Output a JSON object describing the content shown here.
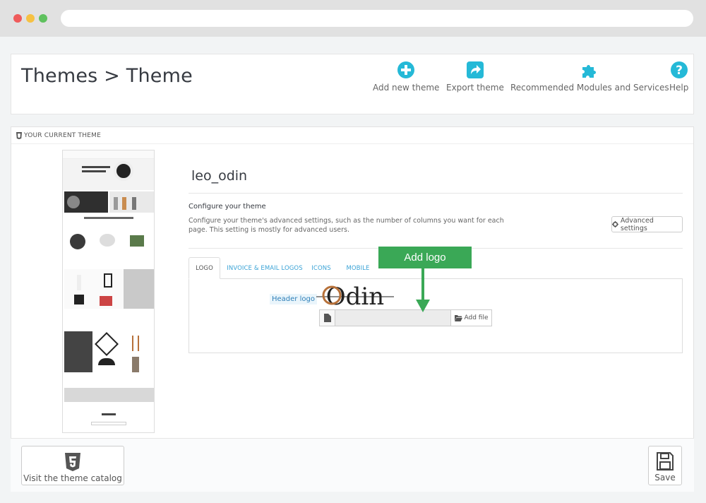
{
  "header": {
    "title": "Themes > Theme",
    "toolbar": [
      {
        "id": "add",
        "label": "Add new theme",
        "icon": "plus-circle-icon"
      },
      {
        "id": "export",
        "label": "Export theme",
        "icon": "share-arrow-icon"
      },
      {
        "id": "modules",
        "label": "Recommended Modules and Services",
        "icon": "puzzle-icon"
      },
      {
        "id": "help",
        "label": "Help",
        "icon": "question-circle-icon"
      }
    ]
  },
  "panel": {
    "heading": "YOUR CURRENT THEME",
    "theme_name": "leo_odin",
    "configure_title": "Configure your theme",
    "configure_desc": "Configure your theme's advanced settings, such as the number of columns you want for each page. This setting is mostly for advanced users.",
    "advanced_button": "Advanced settings",
    "tabs": [
      "LOGO",
      "INVOICE & EMAIL LOGOS",
      "ICONS",
      "MOBILE"
    ],
    "header_logo_label": "Header logo",
    "logo_text": "Odin",
    "add_file_label": "Add file",
    "file_value": ""
  },
  "callout": {
    "text": "Add logo"
  },
  "footer": {
    "catalog_button": "Visit the theme catalog",
    "save_button": "Save"
  },
  "colors": {
    "accent": "#25b9d7",
    "callout": "#3aa856"
  }
}
